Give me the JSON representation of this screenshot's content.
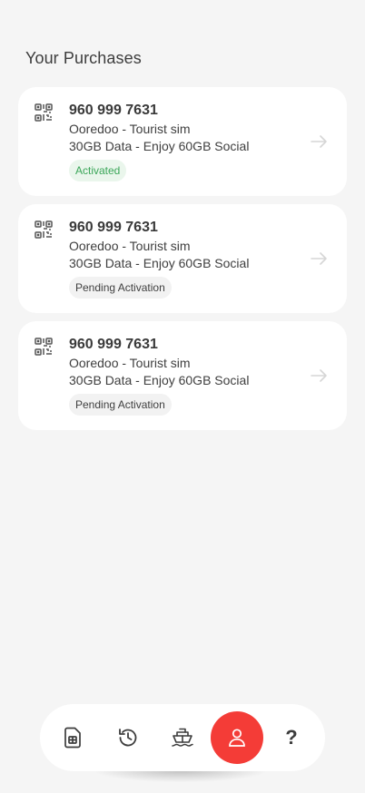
{
  "page": {
    "title": "Your Purchases"
  },
  "purchases": [
    {
      "number": "960 999 7631",
      "plan": "Ooredoo - Tourist sim",
      "details": "30GB Data - Enjoy 60GB Social",
      "status": "Activated",
      "status_color": "#3ba659"
    },
    {
      "number": "960 999 7631",
      "plan": "Ooredoo - Tourist sim",
      "details": "30GB Data - Enjoy 60GB Social",
      "status": "Pending Activation",
      "status_color": "#3f3f3f"
    },
    {
      "number": "960 999 7631",
      "plan": "Ooredoo - Tourist sim",
      "details": "30GB Data - Enjoy 60GB Social",
      "status": "Pending Activation",
      "status_color": "#3f3f3f"
    }
  ],
  "nav": {
    "items": [
      {
        "icon": "sim-card-icon",
        "active": false
      },
      {
        "icon": "history-icon",
        "active": false
      },
      {
        "icon": "ship-icon",
        "active": false
      },
      {
        "icon": "user-icon",
        "active": true
      },
      {
        "icon": "help-icon",
        "active": false,
        "glyph": "?"
      }
    ],
    "accent": "#f43c37"
  }
}
